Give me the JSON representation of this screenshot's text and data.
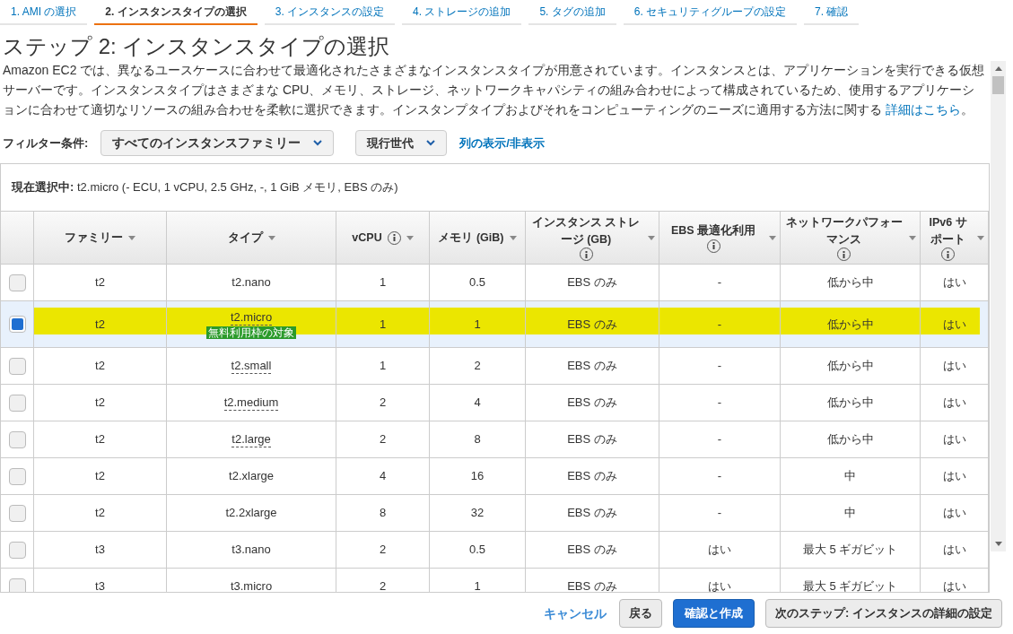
{
  "steps": [
    {
      "label": "1. AMI の選択",
      "selected": false
    },
    {
      "label": "2. インスタンスタイプの選択",
      "selected": true
    },
    {
      "label": "3. インスタンスの設定",
      "selected": false
    },
    {
      "label": "4. ストレージの追加",
      "selected": false
    },
    {
      "label": "5. タグの追加",
      "selected": false
    },
    {
      "label": "6. セキュリティグループの設定",
      "selected": false
    },
    {
      "label": "7. 確認",
      "selected": false
    }
  ],
  "title": "ステップ 2: インスタンスタイプの選択",
  "description": {
    "text": "Amazon EC2 では、異なるユースケースに合わせて最適化されたさまざまなインスタンスタイプが用意されています。インスタンスとは、アプリケーションを実行できる仮想サーバーです。インスタンスタイプはさまざまな CPU、メモリ、ストレージ、ネットワークキャパシティの組み合わせによって構成されているため、使用するアプリケーションに合わせて適切なリソースの組み合わせを柔軟に選択できます。インスタンプタイプおよびそれをコンピューティングのニーズに適用する方法に関する",
    "link": "詳細はこちら",
    "after": "。"
  },
  "filter": {
    "label": "フィルター条件:",
    "family": "すべてのインスタンスファミリー",
    "generation": "現行世代",
    "columns_link": "列の表示/非表示"
  },
  "current_selection": {
    "label": "現在選択中:",
    "value": "t2.micro (- ECU, 1 vCPU, 2.5 GHz, -, 1 GiB メモリ, EBS のみ)"
  },
  "table": {
    "columns": [
      {
        "label": "ファミリー",
        "info": false
      },
      {
        "label": "タイプ",
        "info": false
      },
      {
        "label": "vCPU",
        "info": true
      },
      {
        "label": "メモリ (GiB)",
        "info": false
      },
      {
        "label": "インスタンス ストレージ (GB)",
        "info": true
      },
      {
        "label": "EBS 最適化利用",
        "info": true
      },
      {
        "label": "ネットワークパフォーマンス",
        "info": true
      },
      {
        "label": "IPv6 サポート",
        "info": true
      }
    ],
    "rows": [
      {
        "selected": false,
        "highlighted": false,
        "underlined": false,
        "cells": [
          "t2",
          "t2.nano",
          "1",
          "0.5",
          "EBS のみ",
          "-",
          "低から中",
          "はい"
        ]
      },
      {
        "selected": true,
        "highlighted": true,
        "underlined": true,
        "badge": "無料利用枠の対象",
        "cells": [
          "t2",
          "t2.micro",
          "1",
          "1",
          "EBS のみ",
          "-",
          "低から中",
          "はい"
        ]
      },
      {
        "selected": false,
        "highlighted": false,
        "underlined": true,
        "cells": [
          "t2",
          "t2.small",
          "1",
          "2",
          "EBS のみ",
          "-",
          "低から中",
          "はい"
        ]
      },
      {
        "selected": false,
        "highlighted": false,
        "underlined": true,
        "cells": [
          "t2",
          "t2.medium",
          "2",
          "4",
          "EBS のみ",
          "-",
          "低から中",
          "はい"
        ]
      },
      {
        "selected": false,
        "highlighted": false,
        "underlined": true,
        "cells": [
          "t2",
          "t2.large",
          "2",
          "8",
          "EBS のみ",
          "-",
          "低から中",
          "はい"
        ]
      },
      {
        "selected": false,
        "highlighted": false,
        "underlined": false,
        "cells": [
          "t2",
          "t2.xlarge",
          "4",
          "16",
          "EBS のみ",
          "-",
          "中",
          "はい"
        ]
      },
      {
        "selected": false,
        "highlighted": false,
        "underlined": false,
        "cells": [
          "t2",
          "t2.2xlarge",
          "8",
          "32",
          "EBS のみ",
          "-",
          "中",
          "はい"
        ]
      },
      {
        "selected": false,
        "highlighted": false,
        "underlined": false,
        "cells": [
          "t3",
          "t3.nano",
          "2",
          "0.5",
          "EBS のみ",
          "はい",
          "最大 5 ギガビット",
          "はい"
        ]
      },
      {
        "selected": false,
        "highlighted": false,
        "underlined": false,
        "cells": [
          "t3",
          "t3.micro",
          "2",
          "1",
          "EBS のみ",
          "はい",
          "最大 5 ギガビット",
          "はい"
        ]
      }
    ]
  },
  "footer": {
    "cancel": "キャンセル",
    "back": "戻る",
    "review": "確認と作成",
    "next": "次のステップ: インスタンスの詳細の設定"
  }
}
